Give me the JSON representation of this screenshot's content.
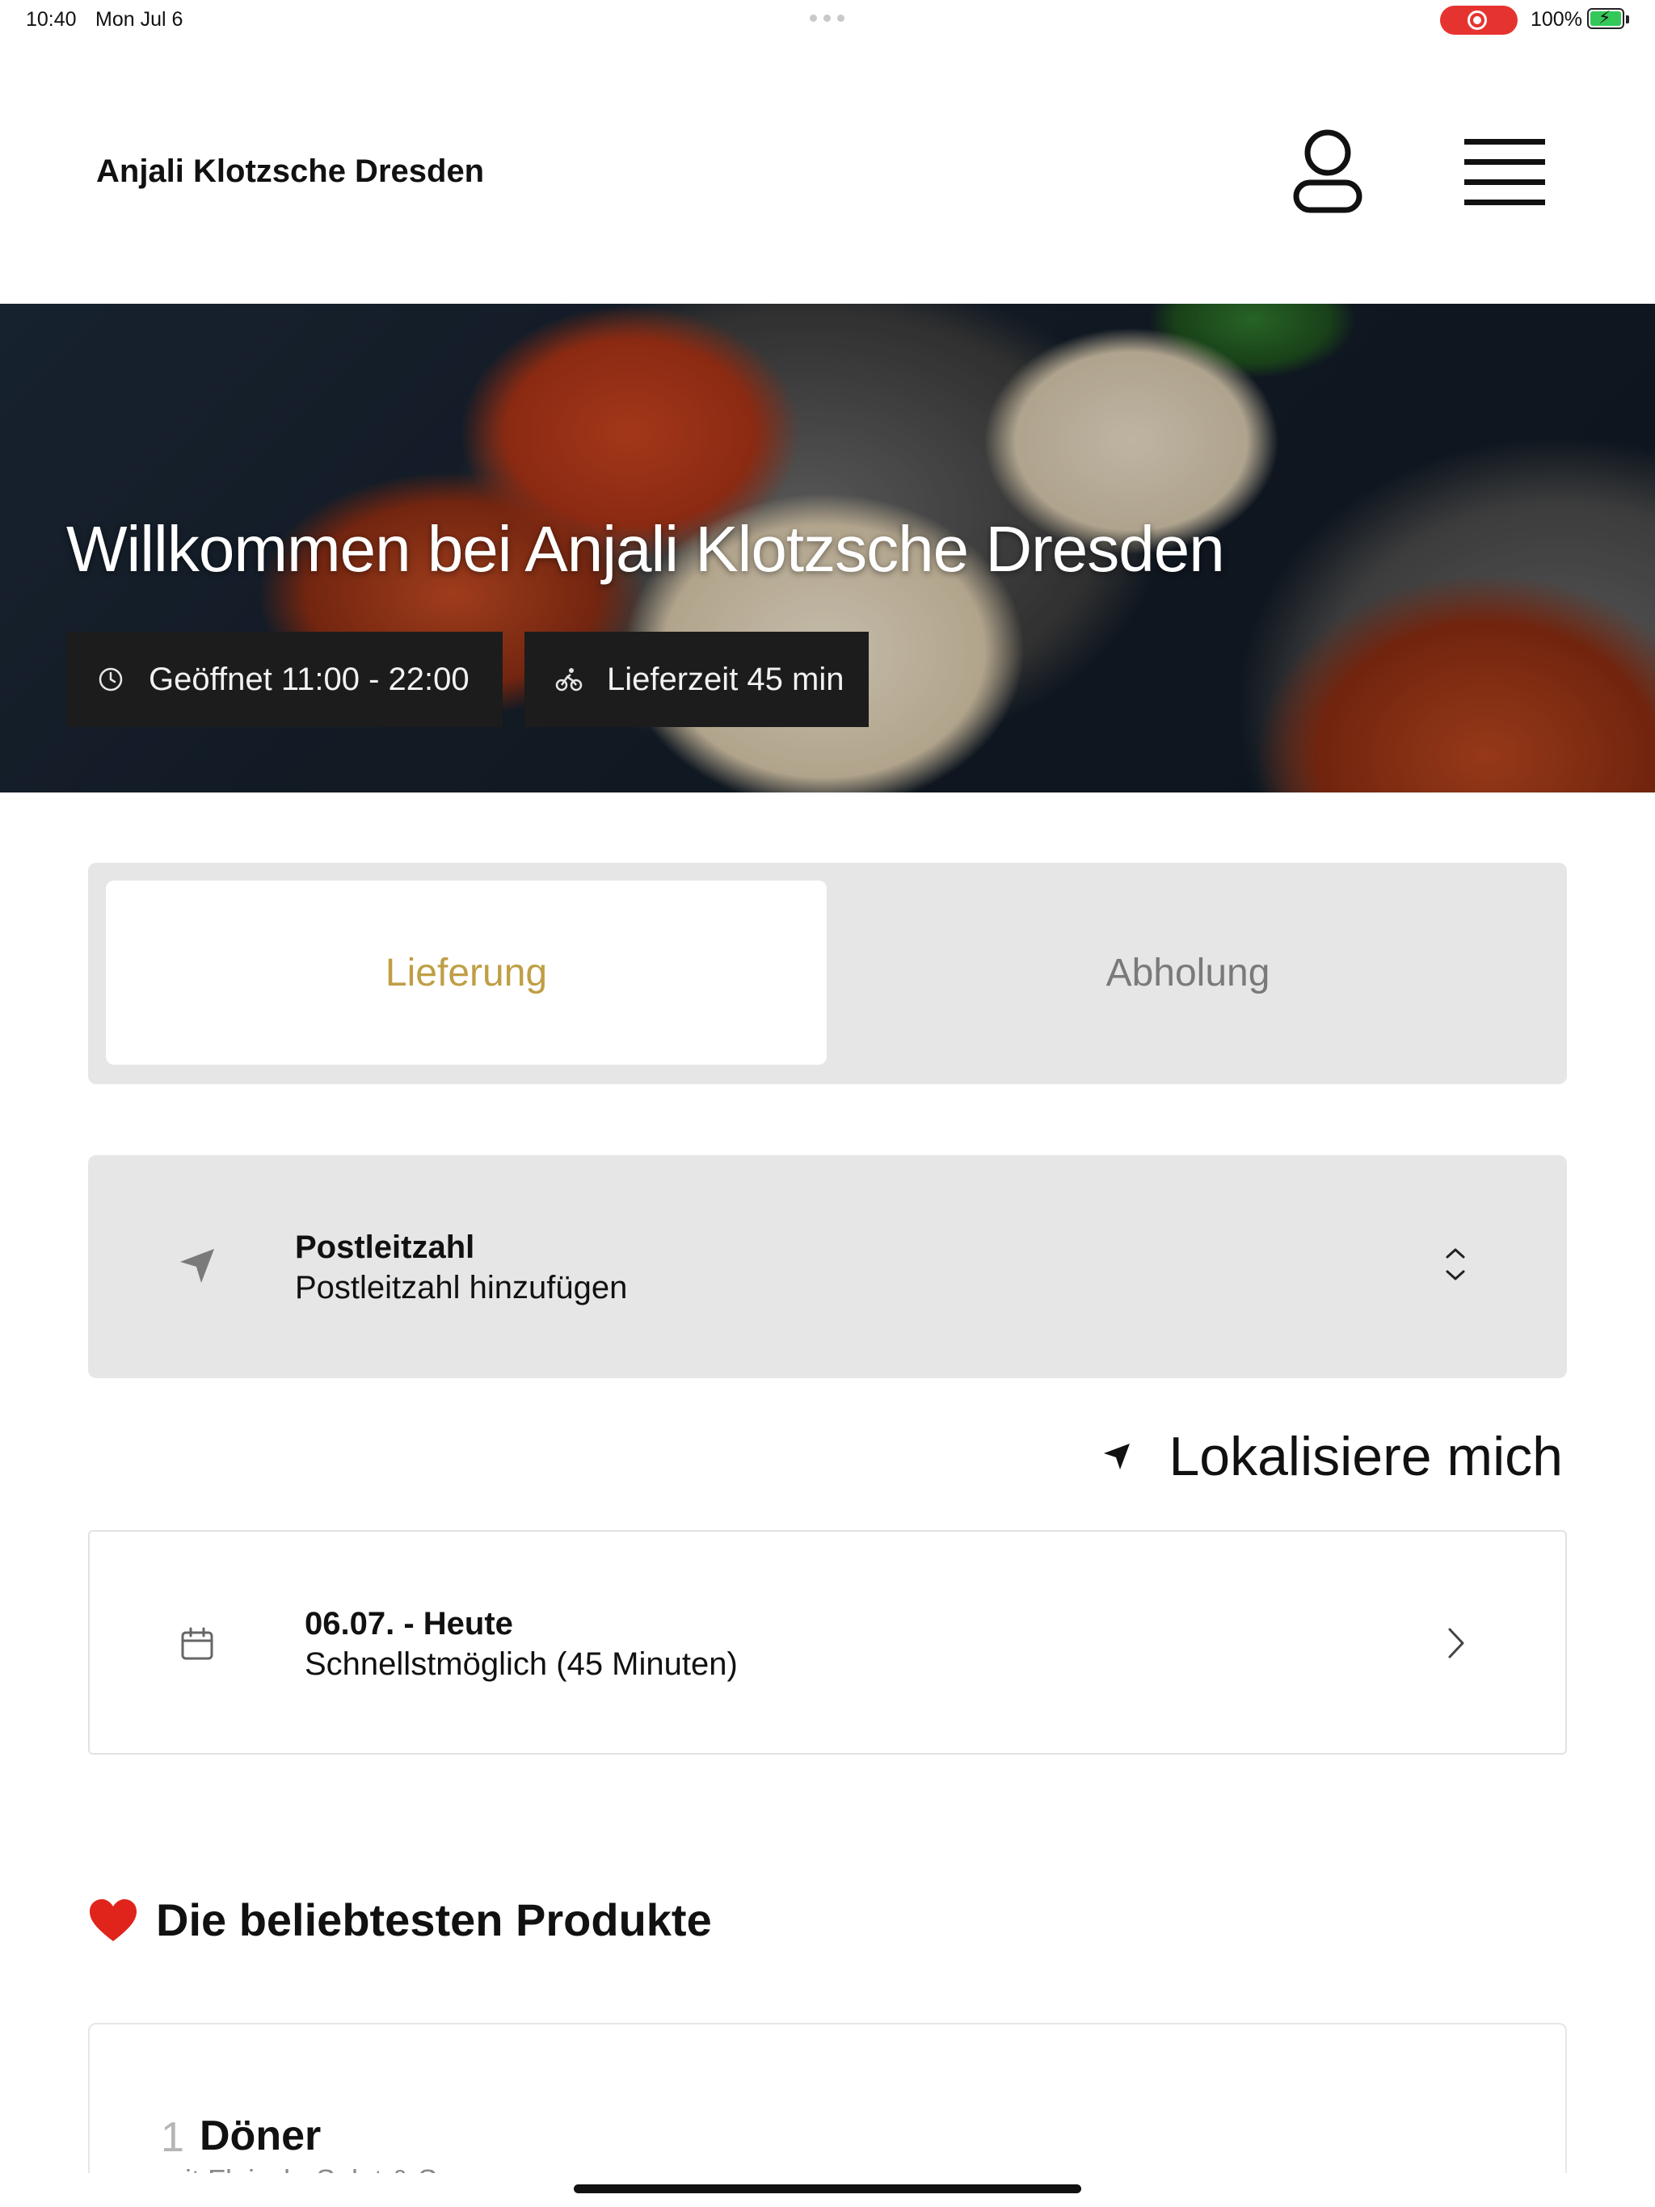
{
  "status_bar": {
    "time": "10:40",
    "date": "Mon Jul 6",
    "battery": "100%",
    "recording_color": "#e5342f",
    "battery_color": "#34c759"
  },
  "header": {
    "brand": "Anjali Klotzsche Dresden",
    "icons": [
      "user-icon",
      "menu-icon"
    ]
  },
  "hero": {
    "title": "Willkommen bei Anjali Klotzsche Dresden",
    "opening_hours": "Geöffnet 11:00 - 22:00",
    "delivery_time": "Lieferzeit 45 min",
    "icons": [
      "clock-icon",
      "bike-icon"
    ]
  },
  "mode_toggle": {
    "options": [
      "Lieferung",
      "Abholung"
    ],
    "selected": "Lieferung",
    "accent_color": "#bf9e45"
  },
  "zip": {
    "label": "Postleitzahl",
    "placeholder": "Postleitzahl hinzufügen",
    "icons": [
      "location-arrow-icon",
      "chevron-updown-icon"
    ]
  },
  "locate": {
    "label": "Lokalisiere mich"
  },
  "delivery_date": {
    "title": "06.07. - Heute",
    "subtitle": "Schnellstmöglich (45 Minuten)",
    "icons": [
      "calendar-icon",
      "chevron-right-icon"
    ]
  },
  "popular": {
    "title": "Die beliebtesten Produkte",
    "icon": "heart-icon",
    "products": [
      {
        "number": "1",
        "name": "Döner",
        "description": "mit Fleisch, Salat & Sauce"
      }
    ]
  }
}
